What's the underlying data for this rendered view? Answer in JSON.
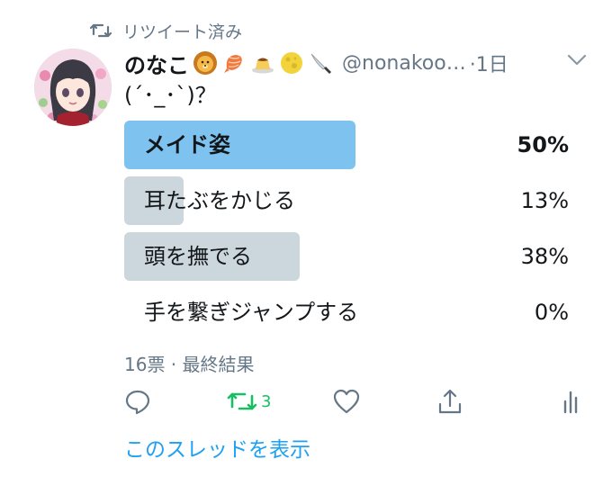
{
  "retweet_header": {
    "label": "リツイート済み"
  },
  "tweet": {
    "display_name": "のなこ",
    "name_emojis": [
      "lion-face",
      "shrimp",
      "custard-pudding",
      "full-moon",
      "kitchen-knife"
    ],
    "handle": "@nonakoo…",
    "time": "·1日",
    "text": "(´･_･`)？"
  },
  "poll": {
    "options": [
      {
        "label": "メイド姿",
        "percent_text": "50%",
        "percent": 50,
        "winner": true
      },
      {
        "label": "耳たぶをかじる",
        "percent_text": "13%",
        "percent": 13,
        "winner": false
      },
      {
        "label": "頭を撫でる",
        "percent_text": "38%",
        "percent": 38,
        "winner": false
      },
      {
        "label": "手を繋ぎジャンプする",
        "percent_text": "0%",
        "percent": 0,
        "winner": false
      }
    ],
    "meta": "16票 · 最終結果"
  },
  "actions": {
    "reply_icon": "reply-icon",
    "retweet_icon": "retweet-icon",
    "retweet_count": "3",
    "like_icon": "heart-icon",
    "share_icon": "share-icon",
    "analytics_icon": "analytics-icon"
  },
  "thread_link": "このスレッドを表示",
  "colors": {
    "accent": "#1da1f2",
    "retweet_active": "#17bf63",
    "muted": "#657786",
    "poll_winner": "#7ec2f0",
    "poll_bar": "#ccd6dd"
  }
}
